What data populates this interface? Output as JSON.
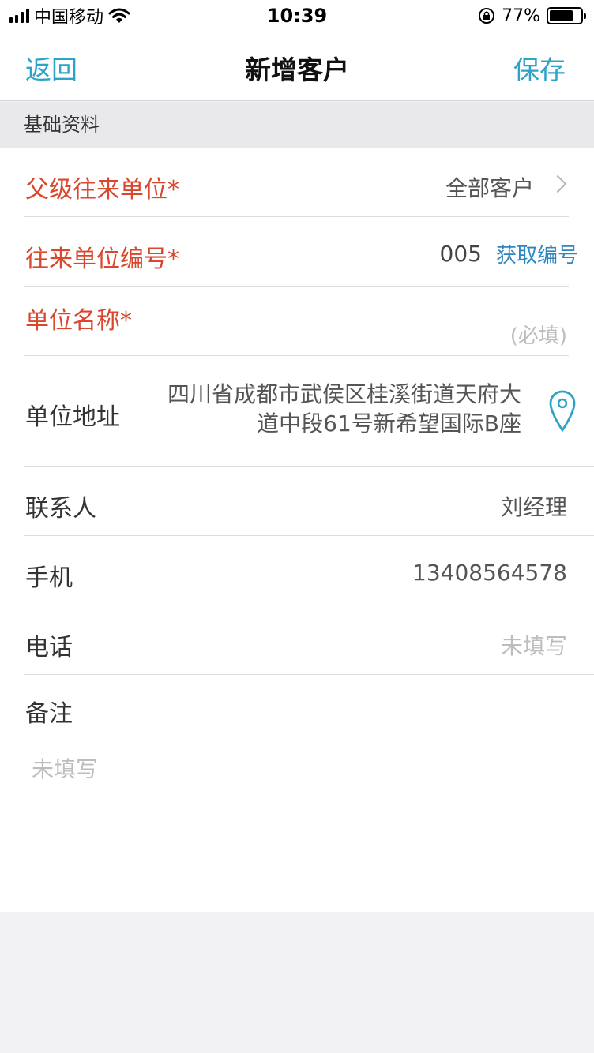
{
  "status_bar": {
    "carrier": "中国移动",
    "time": "10:39",
    "battery_percent": "77%",
    "battery_level": 0.77,
    "icons": [
      "signal-icon",
      "wifi-icon",
      "rotation-lock-icon",
      "battery-icon"
    ]
  },
  "nav": {
    "back_label": "返回",
    "title": "新增客户",
    "save_label": "保存"
  },
  "section": {
    "title": "基础资料"
  },
  "form": {
    "parent_unit": {
      "label": "父级往来单位*",
      "value": "全部客户"
    },
    "unit_code": {
      "label": "往来单位编号*",
      "value": "005",
      "action": "获取编号"
    },
    "unit_name": {
      "label": "单位名称*",
      "placeholder": "(必填)"
    },
    "address": {
      "label": "单位地址",
      "value": "四川省成都市武侯区桂溪街道天府大道中段61号新希望国际B座"
    },
    "contact": {
      "label": "联系人",
      "value": "刘经理"
    },
    "mobile": {
      "label": "手机",
      "value": "13408564578"
    },
    "phone": {
      "label": "电话",
      "placeholder": "未填写"
    },
    "remark": {
      "label": "备注",
      "placeholder": "未填写"
    }
  },
  "colors": {
    "accent": "#2ea3c8",
    "required": "#d9472c",
    "link": "#2e86c1"
  }
}
